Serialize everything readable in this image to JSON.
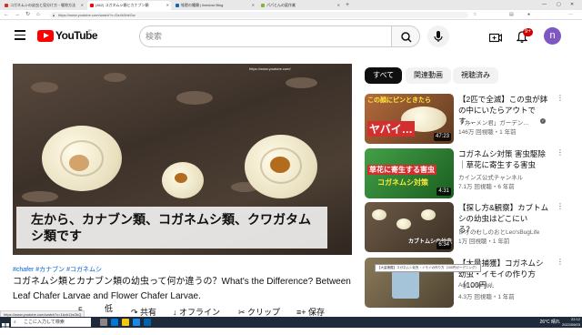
{
  "browser": {
    "tabs": [
      {
        "label": "コガネムシの幼虫と見分け方・駆除方法",
        "color": "#d32f2f",
        "active": false
      },
      {
        "label": "(462) コガネムシ類とカナブン類",
        "color": "#ff0000",
        "active": true
      },
      {
        "label": "堆肥の種類 | livedoor Blog",
        "color": "#1565c0",
        "active": false
      },
      {
        "label": "パパとんの庭作業",
        "color": "#7cb342",
        "active": false
      }
    ],
    "url": "https://www.youtube.com/watch?v=Dz4kXbkGw"
  },
  "header": {
    "logo_text": "YouTube",
    "logo_region": "JP",
    "search_placeholder": "検索",
    "notification_count": "9+",
    "avatar_letter": "n"
  },
  "video": {
    "caption": "左から、カナブン類、コガネムシ類、クワガタムシ類です",
    "watermark": "https://www.youtube.com/",
    "hashtags": "#chafer #カナブン #コガネムシ",
    "title": "コガネムシ類とカナブン類の幼虫って何か違うの？What's the Difference? Between Leaf Chafer Larvae and Flower Chafer Larvae.",
    "actions": {
      "like_count": "5",
      "dislike_label": "低",
      "share_label": "共有",
      "offline_label": "オフライン",
      "clip_label": "クリップ",
      "save_label": "保存"
    }
  },
  "chips": [
    "すべて",
    "関連動画",
    "視聴済み"
  ],
  "related": [
    {
      "title": "【2匹で全滅】この虫が鉢の中にいたらアウトです…",
      "channel": "「カーメン君」ガーデン…",
      "meta": "146万 回視聴・1 年前",
      "duration": "47:23",
      "thumb_text": "ヤバイ…",
      "thumb_top": "この顔にピンときたら",
      "thumb_color": "#b56b3b"
    },
    {
      "title": "コガネムシ対策 害虫駆除｜草花に寄生する害虫",
      "channel": "カインズ公式チャンネル",
      "meta": "7.1万 回視聴・6 年前",
      "duration": "4:31",
      "thumb_text": "草花に寄生する害虫",
      "thumb_top": "コガネムシ対策",
      "thumb_color": "#2e7d32"
    },
    {
      "title": "【探し方&観察】カブトムシの幼虫はどこにいる？…",
      "channel": "レオのむしのおとLeo'sBugLife",
      "meta": "1万 回視聴・1 年前",
      "duration": "6:34",
      "thumb_text": "カブトムシの幼虫",
      "thumb_top": "",
      "thumb_color": "#6d5b48"
    },
    {
      "title": "【大量捕獲】コガネムシ幼虫・イモイの作り方（100円…",
      "channel": "Agri Channel",
      "meta": "4.3万 回視聴・1 年前",
      "duration": "",
      "thumb_text": "",
      "thumb_top": "",
      "thumb_color": "#8a7a5a"
    }
  ],
  "tooltip": "【大量捕獲】コガネムシ幼虫・イモイの作り方（100円ガーデニング）",
  "status_url": "https://www.youtube.com/watch?v=1kcb11sGkQ",
  "taskbar": {
    "search_placeholder": "ここに入力して検索",
    "weather": "26°C 晴れ",
    "time": "22:12",
    "date": "2022/05/03"
  }
}
